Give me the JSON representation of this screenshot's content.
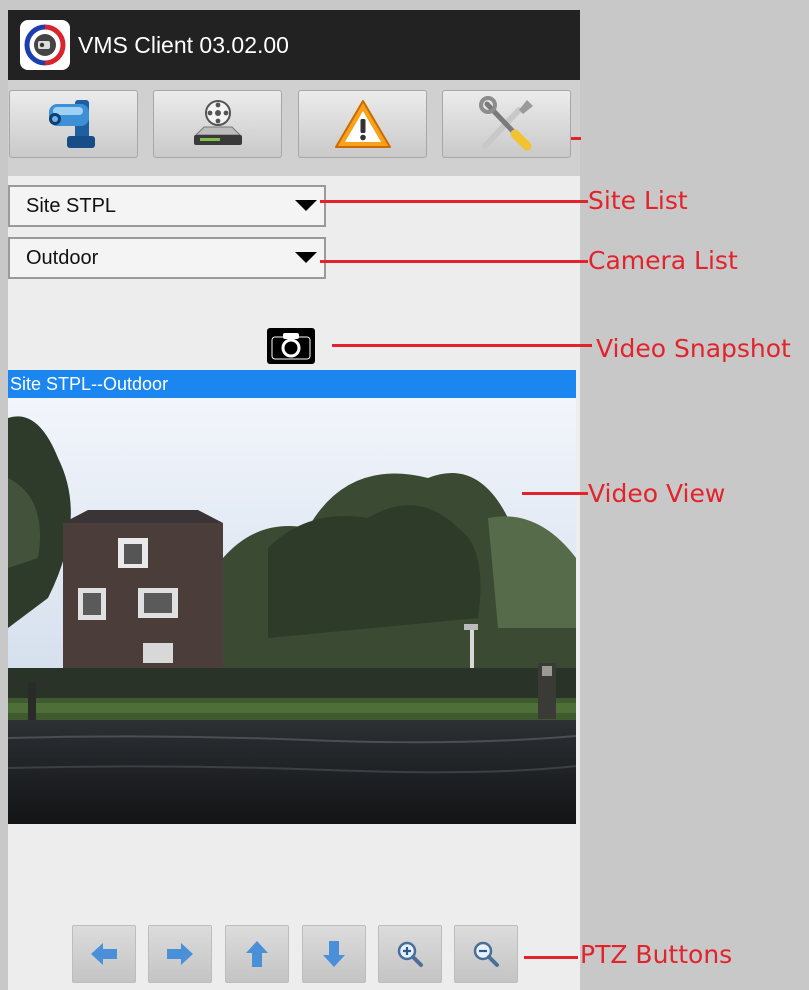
{
  "app": {
    "title": "VMS Client 03.02.00",
    "logo_icon": "vms-camera-logo-icon"
  },
  "toolbar": {
    "buttons": [
      {
        "icon": "cctv-camera-icon"
      },
      {
        "icon": "recorder-device-icon"
      },
      {
        "icon": "warning-alert-icon"
      },
      {
        "icon": "settings-tools-icon"
      }
    ]
  },
  "site_list": {
    "selected": "Site STPL"
  },
  "camera_list": {
    "selected": "Outdoor"
  },
  "snapshot": {
    "icon": "camera-snapshot-icon"
  },
  "video": {
    "title": "Site STPL--Outdoor"
  },
  "ptz": {
    "buttons": [
      {
        "icon": "arrow-left-icon"
      },
      {
        "icon": "arrow-right-icon"
      },
      {
        "icon": "arrow-up-icon"
      },
      {
        "icon": "arrow-down-icon"
      },
      {
        "icon": "zoom-in-icon"
      },
      {
        "icon": "zoom-out-icon"
      }
    ]
  },
  "annotations": {
    "site_list": "Site List",
    "camera_list": "Camera List",
    "video_snapshot": "Video Snapshot",
    "video_view": "Video View",
    "ptz_buttons": "PTZ Buttons"
  },
  "colors": {
    "titlebar": "#222222",
    "view_title_bar": "#1c86f0",
    "annotation": "#e3232b",
    "ptz_arrow": "#4a90d9"
  }
}
